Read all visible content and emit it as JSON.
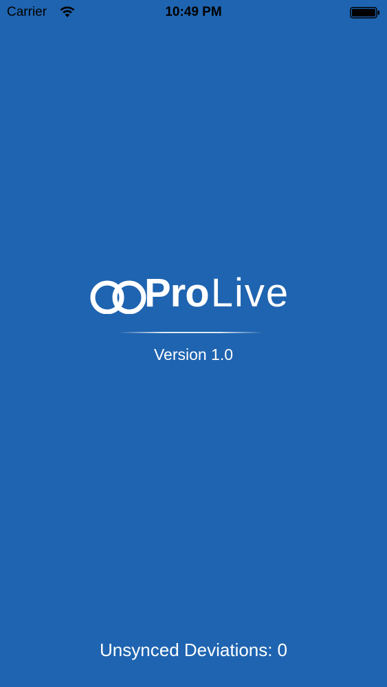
{
  "status_bar": {
    "carrier": "Carrier",
    "time": "10:49 PM",
    "wifi_icon": "wifi-icon",
    "battery_icon": "battery-icon"
  },
  "splash": {
    "logo_bold": "Pro",
    "logo_light": "Live",
    "logo_rings_icon": "double-ring-logo-icon",
    "version": "Version 1.0"
  },
  "footer": {
    "unsynced_label": "Unsynced Deviations:",
    "unsynced_count": "0"
  },
  "colors": {
    "background": "#1f64b0",
    "text": "#ffffff",
    "status_text": "#000000"
  }
}
